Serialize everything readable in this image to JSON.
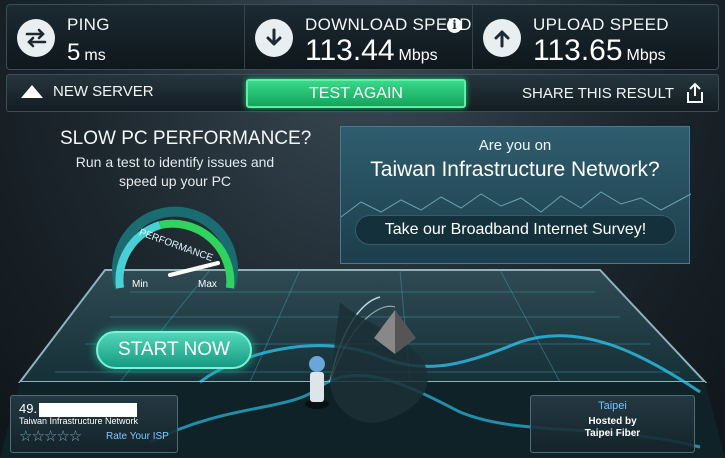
{
  "stats": {
    "ping": {
      "label": "PING",
      "value": "5",
      "unit": "ms",
      "icon": "ping-arrows-icon"
    },
    "download": {
      "label": "DOWNLOAD SPEED",
      "value": "113.44",
      "unit": "Mbps",
      "icon": "download-arrow-icon",
      "info": "i"
    },
    "upload": {
      "label": "UPLOAD SPEED",
      "value": "113.65",
      "unit": "Mbps",
      "icon": "upload-arrow-icon"
    }
  },
  "actions": {
    "new_server": "NEW SERVER",
    "test_again": "TEST AGAIN",
    "share": "SHARE THIS RESULT"
  },
  "perf_ad": {
    "title": "SLOW PC PERFORMANCE?",
    "subtitle": "Run a test to identify issues and speed up your PC",
    "gauge_label": "PERFORMANCE",
    "gauge_min": "Min",
    "gauge_max": "Max",
    "button": "START NOW"
  },
  "survey_ad": {
    "pre": "Are you on",
    "title": "Taiwan Infrastructure Network?",
    "button": "Take our Broadband Internet Survey!"
  },
  "isp": {
    "ip_prefix": "49.",
    "name": "Taiwan Infrastructure Network",
    "stars": "☆☆☆☆☆",
    "rate": "Rate Your ISP"
  },
  "server": {
    "city": "Taipei",
    "hosted_by": "Hosted by",
    "host": "Taipei Fiber"
  },
  "colors": {
    "accent_green": "#1ec67a",
    "link_blue": "#73c2ff",
    "survey_bg": "#2f5d6e"
  }
}
